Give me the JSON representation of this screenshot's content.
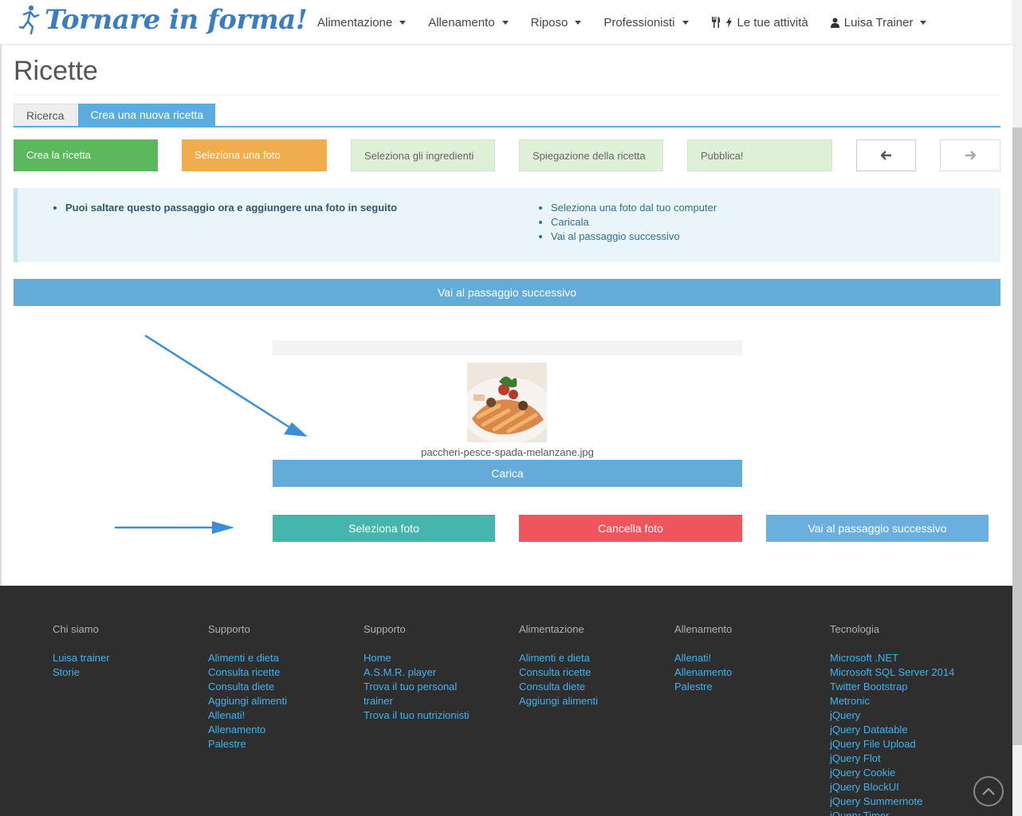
{
  "header": {
    "logo_text": "Tornare in forma!",
    "nav": [
      {
        "label": "Alimentazione"
      },
      {
        "label": "Allenamento"
      },
      {
        "label": "Riposo"
      },
      {
        "label": "Professionisti"
      },
      {
        "label": "Le tue attività"
      },
      {
        "label": "Luisa Trainer"
      }
    ]
  },
  "page": {
    "title": "Ricette",
    "tabs": [
      {
        "label": "Ricerca"
      },
      {
        "label": "Crea una nuova ricetta"
      }
    ],
    "steps": [
      {
        "label": "Crea la ricetta"
      },
      {
        "label": "Seleziona una foto"
      },
      {
        "label": "Seleziona gli ingredienti"
      },
      {
        "label": "Spiegazione della ricetta"
      },
      {
        "label": "Pubblica!"
      }
    ],
    "info": {
      "left_items": [
        "Puoi saltare questo passaggio ora e aggiungere una foto in seguito"
      ],
      "right_items": [
        "Seleziona una foto dal tuo computer",
        "Caricala",
        "Vai al passaggio successivo"
      ]
    },
    "next_bar_label": "Vai al passaggio successivo",
    "upload": {
      "file_name": "paccheri-pesce-spada-melanzane.jpg",
      "upload_label": "Carica",
      "select_label": "Seleziona foto",
      "delete_label": "Cancella foto",
      "next_label": "Vai al passaggio successivo"
    }
  },
  "footer": {
    "columns": [
      {
        "title": "Chi siamo",
        "links": [
          "Luisa trainer",
          "Storie"
        ]
      },
      {
        "title": "Supporto",
        "links": [
          "Alimenti e dieta",
          "Consulta ricette",
          "Consulta diete",
          "Aggiungi alimenti",
          "Allenati!",
          "Allenamento",
          "Palestre"
        ]
      },
      {
        "title": "Supporto",
        "links": [
          "Home",
          "A.S.M.R. player",
          "Trova il tuo personal",
          "trainer",
          "Trova il tuo nutrizionisti"
        ]
      },
      {
        "title": "Alimentazione",
        "links": [
          "Alimenti e dieta",
          "Consulta ricette",
          "Consulta diete",
          "Aggiungi alimenti"
        ]
      },
      {
        "title": "Allenamento",
        "links": [
          "Allenati!",
          "Allenamento",
          "Palestre"
        ]
      },
      {
        "title": "Tecnologia",
        "links": [
          "Microsoft .NET",
          "Microsoft SQL Server 2014",
          "Twitter Bootstrap",
          "Metronic",
          "jQuery",
          "jQuery Datatable",
          "jQuery File Upload",
          "jQuery Flot",
          "jQuery Cookie",
          "jQuery BlockUI",
          "jQuery Summernote",
          "jQuery Timer"
        ]
      }
    ]
  },
  "colors": {
    "brand": "#3a7dc0",
    "primary": "#63acd9",
    "success": "#5cb85c",
    "warning": "#f0ad4e",
    "danger": "#f0555d",
    "teal": "#45b6ad",
    "footer_bg": "#2e2e2e",
    "footer_link": "#3fb3ee"
  },
  "icons": [
    "runner-logo-icon",
    "caret-down-icon",
    "cutlery-icon",
    "bolt-icon",
    "user-icon",
    "arrow-left-icon",
    "arrow-right-icon",
    "chevron-up-icon"
  ]
}
